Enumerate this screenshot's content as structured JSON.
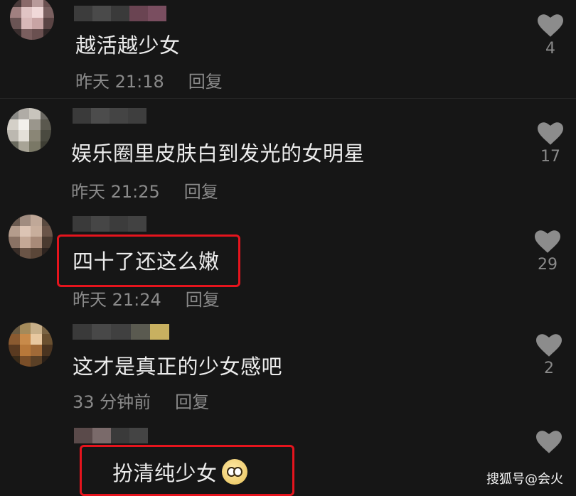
{
  "comments": [
    {
      "text": "越活越少女",
      "time": "昨天 21:18",
      "reply": "回复",
      "likes": "4"
    },
    {
      "text": "娱乐圈里皮肤白到发光的女明星",
      "time": "昨天 21:25",
      "reply": "回复",
      "likes": "17"
    },
    {
      "text": "四十了还这么嫩",
      "time": "昨天 21:24",
      "reply": "回复",
      "likes": "29"
    },
    {
      "text": "这才是真正的少女感吧",
      "time": "33 分钟前",
      "reply": "回复",
      "likes": "2"
    },
    {
      "text": "扮清纯少女",
      "emoji": "pleading-face-emoji"
    }
  ],
  "watermark": "搜狐号@会火",
  "colors": {
    "background": "#161616",
    "highlight": "#e5141d",
    "muted": "#8a8a8a"
  }
}
